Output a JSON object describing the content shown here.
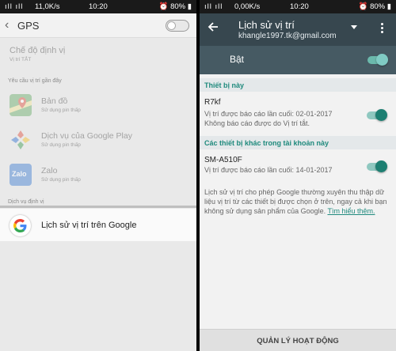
{
  "left": {
    "status": {
      "signal": "ıll ıll",
      "speed": "11,0K/s",
      "time": "10:20",
      "battery": "80%"
    },
    "header": {
      "back_glyph": "‹",
      "title": "GPS"
    },
    "mode": {
      "label": "Chế độ định vị",
      "value": "Vị trí TẮT"
    },
    "recent_header": "Yêu cầu vị trí gần đây",
    "apps": [
      {
        "name": "Bản đồ",
        "sub": "Sử dụng pin thấp",
        "icon": "maps-icon"
      },
      {
        "name": "Dịch vụ của Google Play",
        "sub": "Sử dụng pin thấp",
        "icon": "google-play-services-icon"
      },
      {
        "name": "Zalo",
        "sub": "Sử dụng pin thấp",
        "icon": "zalo-icon",
        "icon_text": "Zalo"
      }
    ],
    "service_header": "Dịch vụ định vị",
    "google_item": {
      "label": "Lịch sử vị trí trên Google"
    }
  },
  "right": {
    "status": {
      "signal": "ıll ıll",
      "speed": "0,00K/s",
      "time": "10:20",
      "battery": "80%"
    },
    "header": {
      "title": "Lịch sử vị trí",
      "email": "khangle1997.tk@gmail.com"
    },
    "master_toggle": {
      "label": "Bật",
      "on": true
    },
    "this_device": {
      "section": "Thiết bị này",
      "name": "R7kf",
      "line1": "Vị trí được báo cáo lần cuối: 02-01-2017",
      "line2": "Không báo cáo được do Vị trí tắt."
    },
    "other_devices": {
      "section": "Các thiết bị khác trong tài khoản này",
      "name": "SM-A510F",
      "line1": "Vị trí được báo cáo lần cuối: 14-01-2017"
    },
    "description": "Lịch sử vị trí cho phép Google thường xuyên thu thập dữ liệu vị trí từ các thiết bị được chọn ở trên, ngay cả khi bạn không sử dụng sản phẩm của Google.",
    "learn_more": "Tìm hiểu thêm.",
    "bottom_button": "QUẢN LÝ HOẠT ĐỘNG"
  },
  "colors": {
    "teal": "#1f8a7d",
    "header_dark": "#37474f",
    "toggle_bar": "#465a63"
  }
}
